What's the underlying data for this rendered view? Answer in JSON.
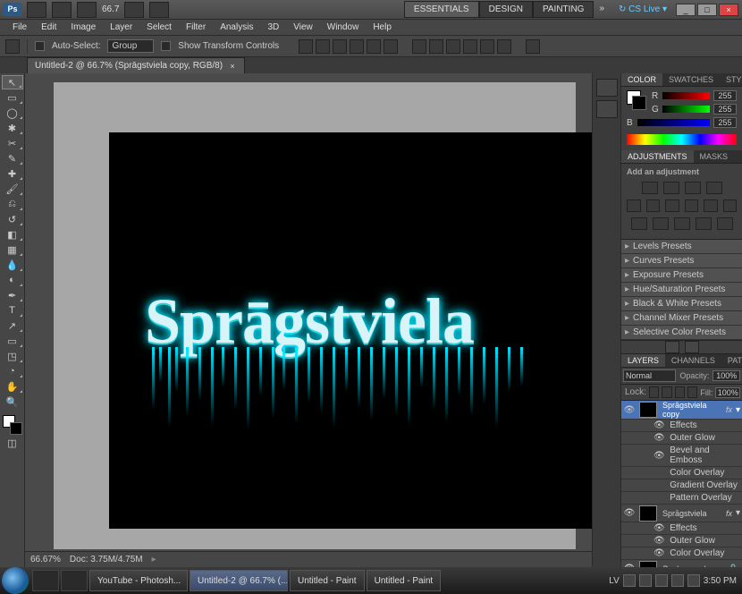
{
  "app": {
    "logo": "Ps",
    "zoom_display": "66.7"
  },
  "workspaces": {
    "essentials": "ESSENTIALS",
    "design": "DESIGN",
    "painting": "PAINTING",
    "more": "»"
  },
  "cslive": "CS Live",
  "window_buttons": {
    "min": "_",
    "max": "□",
    "close": "×"
  },
  "menu": [
    "File",
    "Edit",
    "Image",
    "Layer",
    "Select",
    "Filter",
    "Analysis",
    "3D",
    "View",
    "Window",
    "Help"
  ],
  "options": {
    "auto_select": "Auto-Select:",
    "group": "Group",
    "show_transform": "Show Transform Controls"
  },
  "doc_tab": {
    "title": "Untitled-2 @ 66.7% (Sprāgstviela copy, RGB/8)",
    "close": "×"
  },
  "canvas": {
    "artwork_text": "Sprāgstviela"
  },
  "status": {
    "zoom": "66.67%",
    "doc": "Doc: 3.75M/4.75M"
  },
  "panels": {
    "color": {
      "tabs": [
        "COLOR",
        "SWATCHES",
        "STYLES"
      ],
      "r": {
        "label": "R",
        "val": "255"
      },
      "g": {
        "label": "G",
        "val": "255"
      },
      "b": {
        "label": "B",
        "val": "255"
      }
    },
    "adjustments": {
      "tabs": [
        "ADJUSTMENTS",
        "MASKS"
      ],
      "title": "Add an adjustment",
      "presets": [
        "Levels Presets",
        "Curves Presets",
        "Exposure Presets",
        "Hue/Saturation Presets",
        "Black & White Presets",
        "Channel Mixer Presets",
        "Selective Color Presets"
      ]
    },
    "layers": {
      "tabs": [
        "LAYERS",
        "CHANNELS",
        "PATHS"
      ],
      "blend": "Normal",
      "opacity_label": "Opacity:",
      "opacity": "100%",
      "lock": "Lock:",
      "fill_label": "Fill:",
      "fill": "100%",
      "layer1": {
        "name": "Sprāgstviela copy",
        "fx": "fx"
      },
      "effects": "Effects",
      "effect_items1": [
        "Outer Glow",
        "Bevel and Emboss",
        "Color Overlay",
        "Gradient Overlay",
        "Pattern Overlay"
      ],
      "layer2": {
        "name": "Sprāgstviela",
        "fx": "fx"
      },
      "effect_items2": [
        "Outer Glow",
        "Color Overlay"
      ],
      "layer3": {
        "name": "Background",
        "lock": "🔒"
      }
    }
  },
  "taskbar": {
    "items": [
      {
        "label": "YouTube - Photosh..."
      },
      {
        "label": "Untitled-2 @ 66.7% (..."
      },
      {
        "label": "Untitled - Paint"
      },
      {
        "label": "Untitled - Paint"
      }
    ],
    "lang": "LV",
    "time": "3:50 PM"
  }
}
